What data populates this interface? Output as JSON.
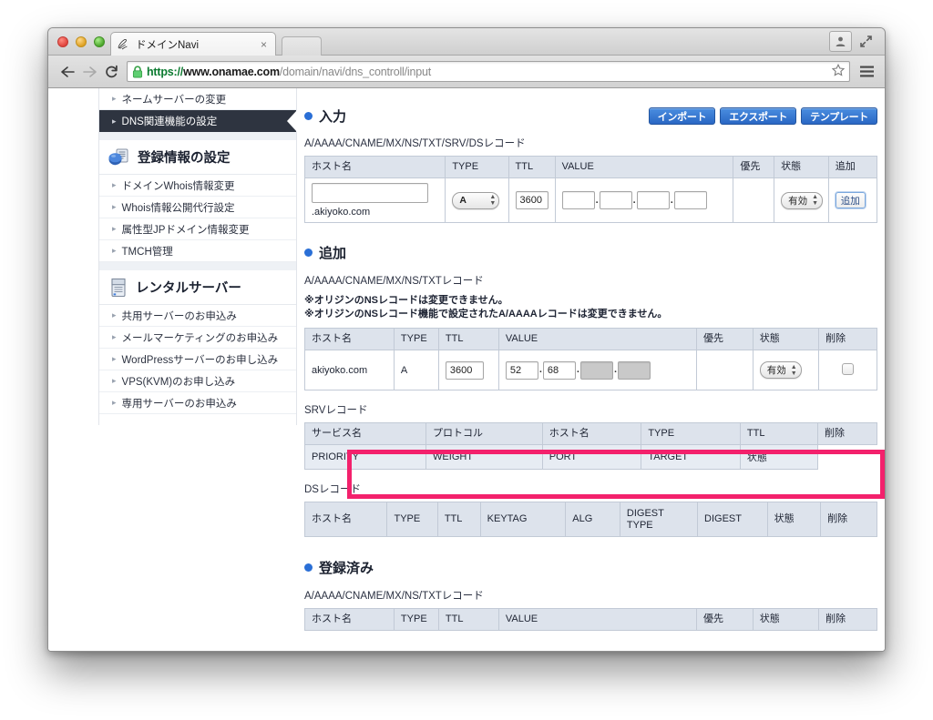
{
  "browser": {
    "tab_title": "ドメインNavi",
    "tab_close": "×",
    "url_scheme": "https://",
    "url_host": "www.onamae.com",
    "url_path": "/domain/navi/dns_controll/input",
    "back_icon": "back-arrow-icon",
    "forward_icon": "forward-arrow-icon",
    "reload_icon": "reload-icon",
    "lock_icon": "lock-icon",
    "star_icon": "star-icon",
    "menu_icon": "hamburger-menu-icon",
    "profile_icon": "profile-avatar-icon",
    "fullscreen_icon": "fullscreen-icon"
  },
  "sidebar": {
    "top_items": [
      {
        "label": "ネームサーバーの変更",
        "active": false
      },
      {
        "label": "DNS関連機能の設定",
        "active": true
      }
    ],
    "sections": [
      {
        "heading": "登録情報の設定",
        "icon": "registration-info-disc-icon",
        "items": [
          {
            "label": "ドメインWhois情報変更"
          },
          {
            "label": "Whois情報公開代行設定"
          },
          {
            "label": "属性型JPドメイン情報変更"
          },
          {
            "label": "TMCH管理"
          }
        ]
      },
      {
        "heading": "レンタルサーバー",
        "icon": "rental-server-icon",
        "items": [
          {
            "label": "共用サーバーのお申込み"
          },
          {
            "label": "メールマーケティングのお申込み"
          },
          {
            "label": "WordPressサーバーのお申し込み"
          },
          {
            "label": "VPS(KVM)のお申し込み"
          },
          {
            "label": "専用サーバーのお申込み"
          }
        ]
      }
    ]
  },
  "main": {
    "input_section": {
      "title": "入力",
      "buttons": [
        {
          "label": "インポート",
          "name": "import-button"
        },
        {
          "label": "エクスポート",
          "name": "export-button"
        },
        {
          "label": "テンプレート",
          "name": "template-button"
        }
      ],
      "record_label": "A/AAAA/CNAME/MX/NS/TXT/SRV/DSレコード",
      "headers": [
        "ホスト名",
        "TYPE",
        "TTL",
        "VALUE",
        "優先",
        "状態",
        "追加"
      ],
      "row": {
        "host_value": "",
        "host_suffix": ".akiyoko.com",
        "type_value": "A",
        "ttl_value": "3600",
        "value_octets": [
          "",
          "",
          "",
          ""
        ],
        "priority": "",
        "state_value": "有効",
        "add_label": "追加"
      }
    },
    "add_section": {
      "title": "追加",
      "record_label": "A/AAAA/CNAME/MX/NS/TXTレコード",
      "notes": [
        "※オリジンのNSレコードは変更できません。",
        "※オリジンのNSレコード機能で設定されたA/AAAAレコードは変更できません。"
      ],
      "headers": [
        "ホスト名",
        "TYPE",
        "TTL",
        "VALUE",
        "優先",
        "状態",
        "削除"
      ],
      "row": {
        "host": "akiyoko.com",
        "type": "A",
        "ttl": "3600",
        "value_octets": [
          "52",
          "68",
          "",
          ""
        ],
        "octet_redacted": [
          false,
          false,
          true,
          true
        ],
        "priority": "",
        "state": "有効",
        "delete_checked": false
      },
      "highlight_color": "#f3216c"
    },
    "srv_section": {
      "label": "SRVレコード",
      "headers": [
        "サービス名",
        "プロトコル",
        "ホスト名",
        "TYPE",
        "TTL",
        "削除"
      ],
      "subheaders": [
        "PRIORITY",
        "WEIGHT",
        "PORT",
        "TARGET",
        "状態",
        ""
      ]
    },
    "ds_section": {
      "label": "DSレコード",
      "headers": [
        "ホスト名",
        "TYPE",
        "TTL",
        "KEYTAG",
        "ALG",
        "DIGEST TYPE",
        "DIGEST",
        "状態",
        "削除"
      ]
    },
    "registered_section": {
      "title": "登録済み",
      "record_label": "A/AAAA/CNAME/MX/NS/TXTレコード",
      "headers": [
        "ホスト名",
        "TYPE",
        "TTL",
        "VALUE",
        "優先",
        "状態",
        "削除"
      ]
    }
  }
}
